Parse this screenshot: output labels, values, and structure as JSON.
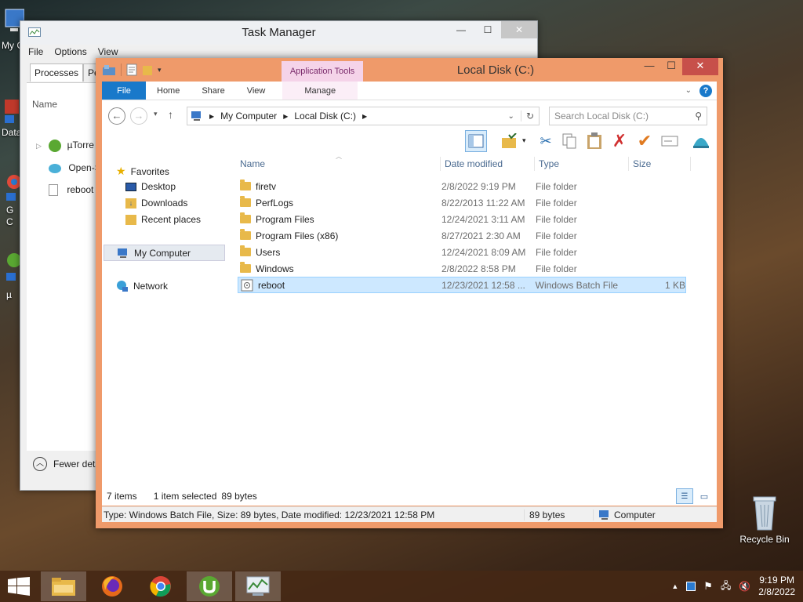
{
  "desktop": {
    "icons": [
      {
        "label": "My C"
      },
      {
        "label": "Data"
      },
      {
        "label": "G"
      },
      {
        "label": "C"
      },
      {
        "label": "µ"
      }
    ],
    "recycle_bin": "Recycle Bin"
  },
  "task_manager": {
    "title": "Task Manager",
    "menu": [
      "File",
      "Options",
      "View"
    ],
    "tabs": [
      "Processes",
      "Per"
    ],
    "column_name": "Name",
    "processes": [
      "µTorre",
      "Open-S",
      "reboot"
    ],
    "fewer_details": "Fewer deta"
  },
  "explorer": {
    "title": "Local Disk (C:)",
    "app_tools": "Application Tools",
    "ribbon_tabs": {
      "file": "File",
      "home": "Home",
      "share": "Share",
      "view": "View",
      "manage": "Manage"
    },
    "breadcrumb": [
      "My Computer",
      "Local Disk (C:)"
    ],
    "search_placeholder": "Search Local Disk (C:)",
    "nav": {
      "favorites": "Favorites",
      "desktop": "Desktop",
      "downloads": "Downloads",
      "recent": "Recent places",
      "computer": "My Computer",
      "network": "Network"
    },
    "columns": {
      "name": "Name",
      "date": "Date modified",
      "type": "Type",
      "size": "Size"
    },
    "files": [
      {
        "name": "firetv",
        "date": "2/8/2022 9:19 PM",
        "type": "File folder",
        "size": ""
      },
      {
        "name": "PerfLogs",
        "date": "8/22/2013 11:22 AM",
        "type": "File folder",
        "size": ""
      },
      {
        "name": "Program Files",
        "date": "12/24/2021 3:11 AM",
        "type": "File folder",
        "size": ""
      },
      {
        "name": "Program Files (x86)",
        "date": "8/27/2021 2:30 AM",
        "type": "File folder",
        "size": ""
      },
      {
        "name": "Users",
        "date": "12/24/2021 8:09 AM",
        "type": "File folder",
        "size": ""
      },
      {
        "name": "Windows",
        "date": "2/8/2022 8:58 PM",
        "type": "File folder",
        "size": ""
      },
      {
        "name": "reboot",
        "date": "12/23/2021 12:58 ...",
        "type": "Windows Batch File",
        "size": "1 KB"
      }
    ],
    "status": {
      "items": "7 items",
      "selected": "1 item selected",
      "size": "89 bytes"
    },
    "details": {
      "text": "Type: Windows Batch File, Size: 89 bytes, Date modified: 12/23/2021 12:58 PM",
      "size": "89 bytes",
      "location": "Computer"
    }
  },
  "taskbar": {
    "clock_time": "9:19 PM",
    "clock_date": "2/8/2022"
  }
}
